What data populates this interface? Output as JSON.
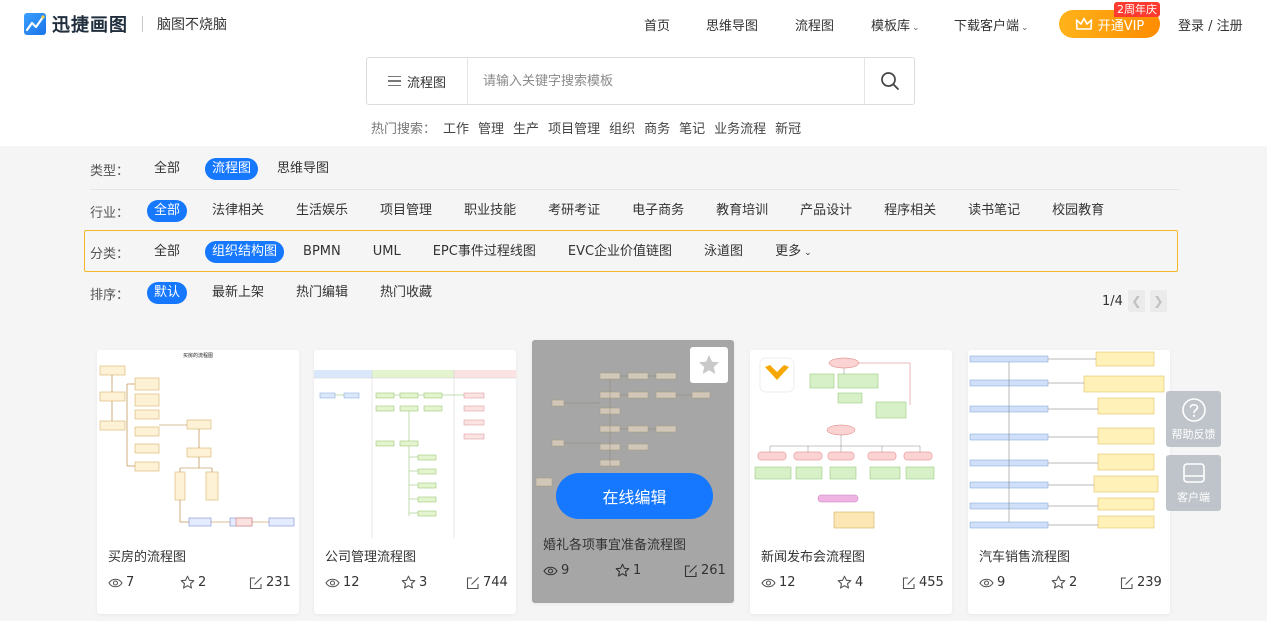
{
  "header": {
    "logo_text": "迅捷画图",
    "slogan": "脑图不烧脑",
    "nav": [
      {
        "label": "首页",
        "dropdown": false
      },
      {
        "label": "思维导图",
        "dropdown": false
      },
      {
        "label": "流程图",
        "dropdown": false
      },
      {
        "label": "模板库",
        "dropdown": true
      },
      {
        "label": "下载客户端",
        "dropdown": true
      }
    ],
    "vip_label": "开通VIP",
    "vip_badge": "2周年庆",
    "login": "登录 / 注册",
    "colors": {
      "accent": "#1677ff",
      "vip": "#ff8c00",
      "badge": "#ff3b30"
    }
  },
  "search": {
    "type_label": "流程图",
    "placeholder": "请输入关键字搜索模板",
    "hot_label": "热门搜索：",
    "hot_items": [
      "工作",
      "管理",
      "生产",
      "项目管理",
      "组织",
      "商务",
      "笔记",
      "业务流程",
      "新冠"
    ]
  },
  "filters": {
    "type": {
      "label": "类型：",
      "options": [
        "全部",
        "流程图",
        "思维导图"
      ],
      "active": "流程图"
    },
    "industry": {
      "label": "行业：",
      "options": [
        "全部",
        "法律相关",
        "生活娱乐",
        "项目管理",
        "职业技能",
        "考研考证",
        "电子商务",
        "教育培训",
        "产品设计",
        "程序相关",
        "读书笔记",
        "校园教育"
      ],
      "active": "全部"
    },
    "category": {
      "label": "分类：",
      "options": [
        "全部",
        "组织结构图",
        "BPMN",
        "UML",
        "EPC事件过程线图",
        "EVC企业价值链图",
        "泳道图"
      ],
      "more": "更多",
      "active": "组织结构图"
    },
    "sort": {
      "label": "排序：",
      "options": [
        "默认",
        "最新上架",
        "热门编辑",
        "热门收藏"
      ],
      "active": "默认"
    }
  },
  "pager": {
    "text": "1/4"
  },
  "cards": [
    {
      "title": "买房的流程图",
      "views": "7",
      "favorites": "2",
      "edits": "231",
      "thumb_heading": "买房的流程图"
    },
    {
      "title": "公司管理流程图",
      "views": "12",
      "favorites": "3",
      "edits": "744"
    },
    {
      "title": "婚礼各项事宜准备流程图",
      "views": "9",
      "favorites": "1",
      "edits": "261",
      "overlay_button": "在线编辑"
    },
    {
      "title": "新闻发布会流程图",
      "views": "12",
      "favorites": "4",
      "edits": "455"
    },
    {
      "title": "汽车销售流程图",
      "views": "9",
      "favorites": "2",
      "edits": "239"
    }
  ],
  "side": {
    "feedback": "帮助反馈",
    "client": "客户端"
  }
}
